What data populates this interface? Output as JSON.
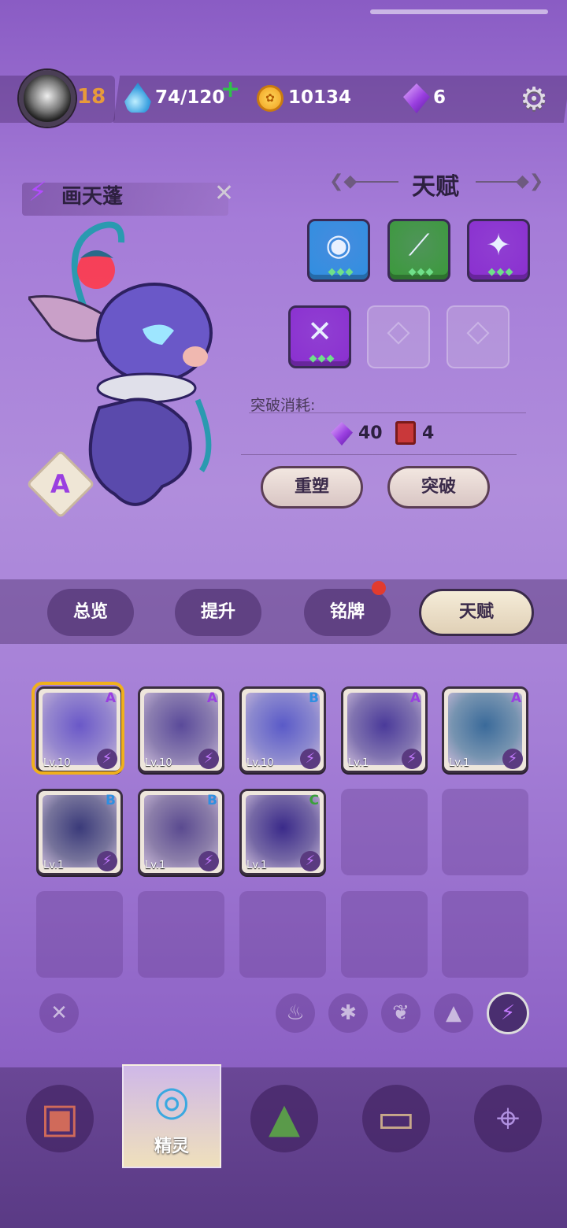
{
  "topbar": {
    "level": "18",
    "energy": "74/120",
    "energy_plus": "+",
    "coins": "10134",
    "gems": "6",
    "icons": {
      "avatar": "player-avatar",
      "energy": "water-drop-icon",
      "coins": "paw-coin-icon",
      "gems": "purple-gem-icon",
      "settings": "gear-icon"
    }
  },
  "spirit": {
    "name": "画天蓬",
    "rank": "A",
    "close": "✕"
  },
  "talent": {
    "title": "天赋",
    "slots": [
      {
        "icon": "eye-skill-icon",
        "color": "#2f8fe0",
        "pips": "◆◆◆"
      },
      {
        "icon": "claw-skill-icon",
        "color": "#3a9a3a",
        "pips": "◆◆◆"
      },
      {
        "icon": "sparkle-skill-icon",
        "color": "#8a2fd0",
        "pips": "◆◆◆"
      },
      {
        "icon": "cross-slash-skill-icon",
        "color": "#8a2fd0",
        "pips": "◆◆◆"
      },
      {
        "icon": "locked-slot-icon",
        "pips": ""
      },
      {
        "icon": "locked-slot-icon",
        "pips": ""
      }
    ],
    "cost_label": "突破消耗:",
    "cost_gem": "40",
    "cost_book": "4",
    "btn_reset": "重塑",
    "btn_break": "突破"
  },
  "tabs": [
    "总览",
    "提升",
    "铭牌",
    "天赋"
  ],
  "active_tab": "天赋",
  "grid": [
    {
      "rank": "A",
      "rank_color": "#9a3fe0",
      "lv": "Lv.10",
      "art": "#6a58c8"
    },
    {
      "rank": "A",
      "rank_color": "#9a3fe0",
      "lv": "Lv.10",
      "art": "#5a4a9a"
    },
    {
      "rank": "B",
      "rank_color": "#2f8fe0",
      "lv": "Lv.10",
      "art": "#5a5ac8"
    },
    {
      "rank": "A",
      "rank_color": "#9a3fe0",
      "lv": "Lv.1",
      "art": "#4a3a9a"
    },
    {
      "rank": "A",
      "rank_color": "#9a3fe0",
      "lv": "Lv.1",
      "art": "#3a6a9a"
    },
    {
      "rank": "B",
      "rank_color": "#2f8fe0",
      "lv": "Lv.1",
      "art": "#3a3a7a"
    },
    {
      "rank": "B",
      "rank_color": "#2f8fe0",
      "lv": "Lv.1",
      "art": "#5a4a90"
    },
    {
      "rank": "C",
      "rank_color": "#3aa03a",
      "lv": "Lv.1",
      "art": "#3a2a8a"
    }
  ],
  "filters": {
    "clear": "✕",
    "icons": [
      "fire-filter-icon",
      "flower-filter-icon",
      "leaf-filter-icon",
      "rock-filter-icon",
      "lightning-filter-icon"
    ],
    "glyphs": [
      "♨",
      "✱",
      "❦",
      "▲",
      "⚡"
    ]
  },
  "nav": {
    "items": [
      "console-icon",
      "spirit-aperture-icon",
      "mountain-icon",
      "chest-icon",
      "map-pin-icon"
    ],
    "spirit_label": "精灵"
  }
}
